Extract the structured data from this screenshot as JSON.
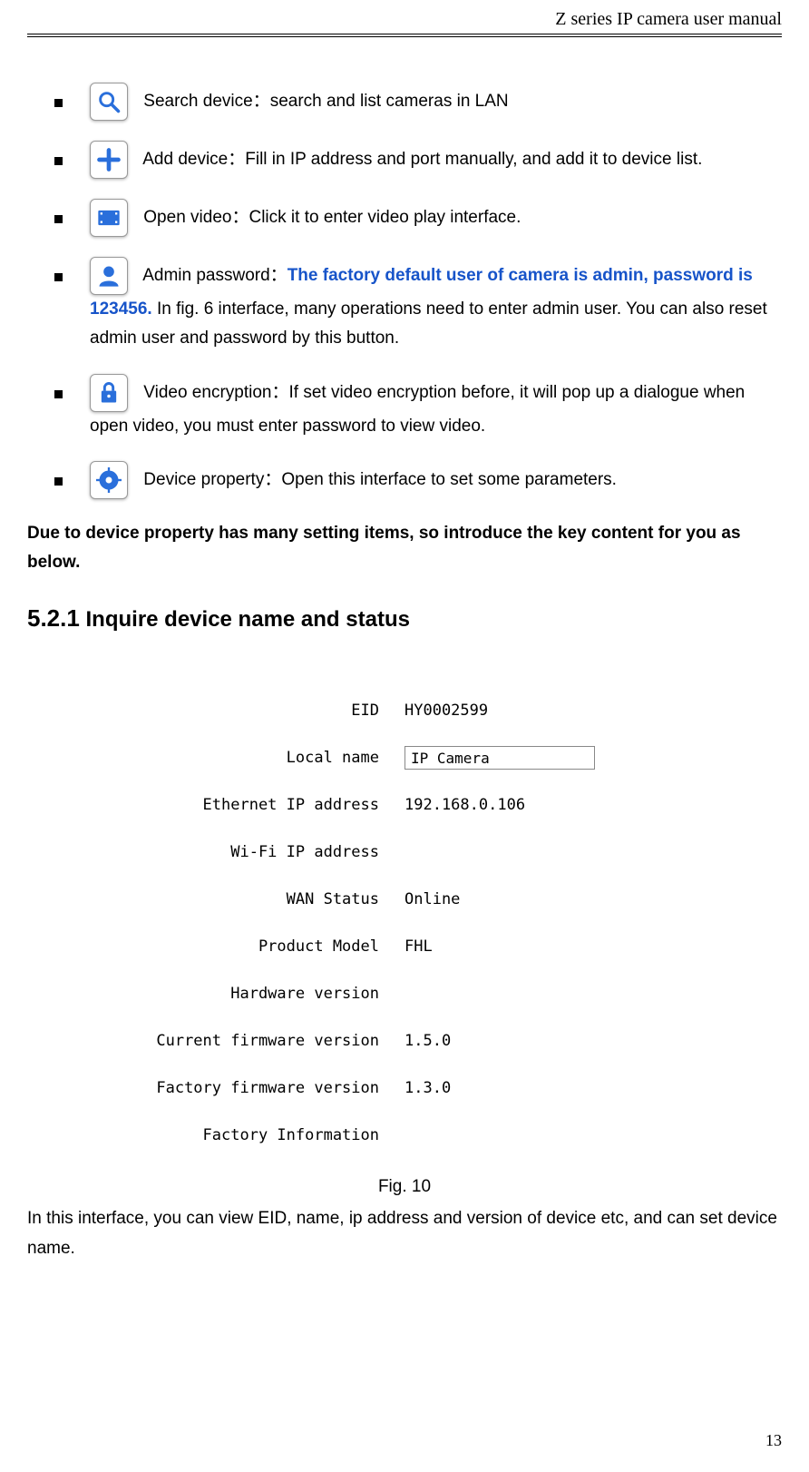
{
  "header_title": "Z series IP camera user manual",
  "bullets": [
    {
      "label": "Search device：",
      "desc": "search and list cameras in LAN"
    },
    {
      "label": "Add device：",
      "desc": "Fill in IP address and port manually, and add it to device list."
    },
    {
      "label": "Open video：",
      "desc": "Click it to enter video play interface."
    },
    {
      "label": "Admin password：",
      "highlight": "The factory default user of camera is admin, password is 123456.",
      "tail": "    In fig. 6 interface, many operations need to enter admin user. You can also reset admin user and password by this button."
    },
    {
      "label": "Video encryption：",
      "desc": "If set video encryption before, it will pop up a dialogue when open video, you must enter password to view video."
    },
    {
      "label": "Device property：",
      "desc": "Open this interface to set some parameters."
    }
  ],
  "note": "Due to device property has many setting items, so introduce the key content for you as below.",
  "section": {
    "number": "5.2.1",
    "title": "Inquire device name and status"
  },
  "device_rows": [
    {
      "label": "EID",
      "value": "HY0002599"
    },
    {
      "label": "Local name",
      "input_value": "IP Camera"
    },
    {
      "label": "Ethernet IP address",
      "value": "192.168.0.106"
    },
    {
      "label": "Wi-Fi IP address",
      "value": ""
    },
    {
      "label": "WAN Status",
      "value": "Online"
    },
    {
      "label": "Product Model",
      "value": "FHL"
    },
    {
      "label": "Hardware version",
      "value": ""
    },
    {
      "label": "Current firmware version",
      "value": "1.5.0"
    },
    {
      "label": "Factory firmware version",
      "value": "1.3.0"
    },
    {
      "label": "Factory Information",
      "value": ""
    }
  ],
  "figure_caption": "Fig. 10",
  "closing_paragraph": "In this interface, you can view EID, name, ip address and version of device etc, and can set device name.",
  "page_number": "13"
}
